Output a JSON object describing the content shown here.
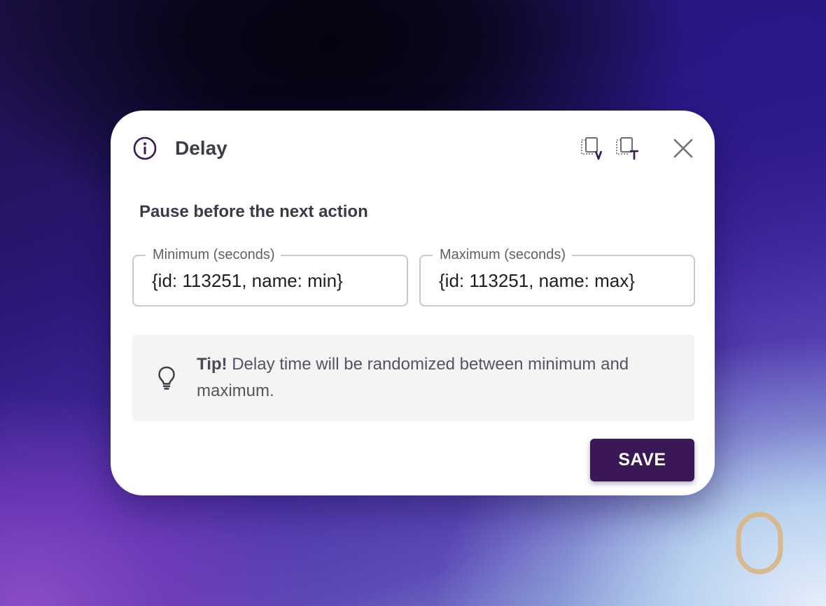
{
  "dialog": {
    "title": "Delay",
    "title_icon": "info-icon",
    "toolbar_icons": [
      "variables-icon",
      "text-icon",
      "close-icon"
    ],
    "subtitle": "Pause before the next action",
    "fields": {
      "minimum": {
        "label": "Minimum (seconds)",
        "value": "{id: 113251, name: min}"
      },
      "maximum": {
        "label": "Maximum (seconds)",
        "value": "{id: 113251, name: max}"
      }
    },
    "tip": {
      "icon": "lightbulb-icon",
      "strong": "Tip!",
      "text": " Delay time will be randomized between minimum and maximum."
    },
    "save_label": "SAVE"
  },
  "colors": {
    "accent": "#3a1856",
    "logo": "#d6b98f"
  }
}
